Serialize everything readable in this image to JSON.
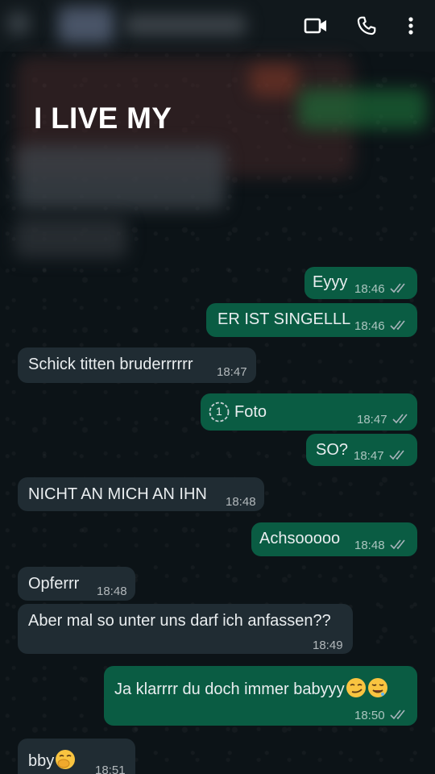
{
  "header": {
    "video_call_icon": "video-call-icon",
    "voice_call_icon": "phone-icon",
    "menu_icon": "more-vertical-icon"
  },
  "overlay_text": "I LIVE MY",
  "colors": {
    "outgoing_bubble": "#0a5c43",
    "incoming_bubble": "#202c33",
    "background": "#0c1317",
    "text": "#e9edef"
  },
  "messages": [
    {
      "direction": "out",
      "text": "Eyyy",
      "time": "18:46",
      "status": "read"
    },
    {
      "direction": "out",
      "text": "ER IST SINGELLL",
      "time": "18:46",
      "status": "read"
    },
    {
      "direction": "in",
      "text": "Schick titten bruderrrrrr",
      "time": "18:47"
    },
    {
      "direction": "out",
      "text": "Foto",
      "time": "18:47",
      "status": "read",
      "media_icon": "view-once-icon",
      "media_label": "1"
    },
    {
      "direction": "out",
      "text": "SO?",
      "time": "18:47",
      "status": "read"
    },
    {
      "direction": "in",
      "text": "NICHT AN MICH AN IHN",
      "time": "18:48"
    },
    {
      "direction": "out",
      "text": "Achsooooo",
      "time": "18:48",
      "status": "read"
    },
    {
      "direction": "in",
      "text": "Opferrr",
      "time": "18:48"
    },
    {
      "direction": "in",
      "text": "Aber mal so unter uns darf ich anfassen??",
      "time": "18:49"
    },
    {
      "direction": "out",
      "text": "Ja klarrrr du doch immer babyyy",
      "time": "18:50",
      "status": "read",
      "emojis": [
        "smirking-face-emoji",
        "drooling-face-emoji"
      ]
    },
    {
      "direction": "in",
      "text": "bby",
      "time": "18:51",
      "emojis": [
        "face-with-hand-over-mouth-emoji"
      ]
    }
  ]
}
